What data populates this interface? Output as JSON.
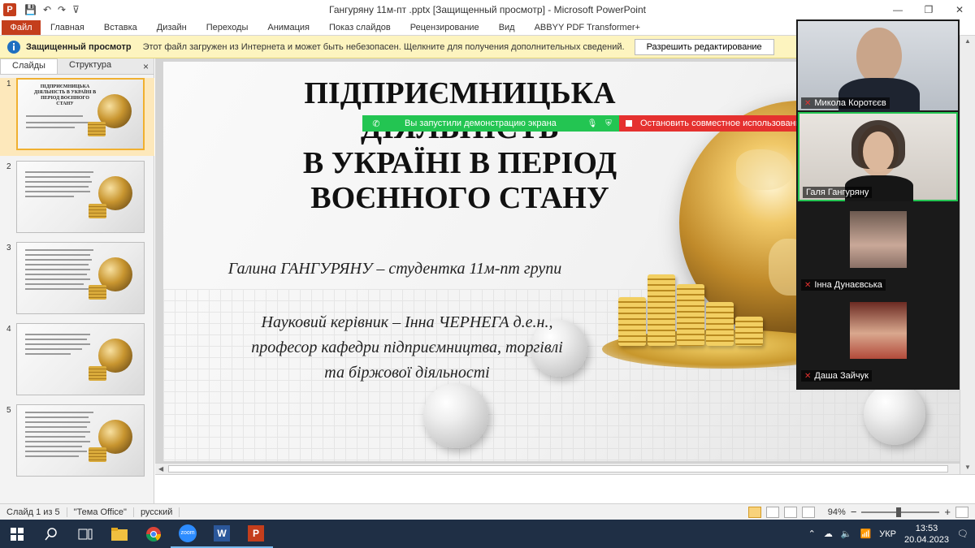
{
  "window": {
    "title": "Гангуряну 11м-пт .pptx [Защищенный просмотр]  -  Microsoft PowerPoint",
    "app_letter": "P",
    "qat_save": "💾",
    "qat_undo": "↶",
    "qat_redo": "↷",
    "qat_more": "⊽",
    "min": "—",
    "restore": "❐",
    "close": "✕"
  },
  "ribbon": {
    "file": "Файл",
    "tabs": [
      "Главная",
      "Вставка",
      "Дизайн",
      "Переходы",
      "Анимация",
      "Показ слайдов",
      "Рецензирование",
      "Вид",
      "ABBYY PDF Transformer+"
    ]
  },
  "message_bar": {
    "title": "Защищенный просмотр",
    "text": "Этот файл загружен из Интернета и может быть небезопасен. Щелкните для получения дополнительных сведений.",
    "button": "Разрешить редактирование"
  },
  "left_panel": {
    "tab_slides": "Слайды",
    "tab_outline": "Структура",
    "close": "×",
    "thumbnails": [
      {
        "num": "1",
        "title": "ПІДПРИЄМНИЦЬКА ДІЯЛЬНІСТЬ В УКРАЇНІ В ПЕРІОД ВОЄННОГО СТАНУ"
      },
      {
        "num": "2",
        "title": ""
      },
      {
        "num": "3",
        "title": ""
      },
      {
        "num": "4",
        "title": ""
      },
      {
        "num": "5",
        "title": ""
      }
    ]
  },
  "slide": {
    "title_lines": [
      "ПІДПРИЄМНИЦЬКА",
      "ДІЯЛЬНІСТЬ",
      "В УКРАЇНІ В ПЕРІОД",
      "ВОЄННОГО СТАНУ"
    ],
    "author": "Галина ГАНГУРЯНУ – студентка 11м-пт групи",
    "advisor_lines": [
      "Науковий керівник – Інна ЧЕРНЕГА  д.е.н.,",
      "професор кафедри підприємництва, торгівлі",
      "та біржової діяльності"
    ]
  },
  "share": {
    "started": "Вы запустили демонстрацию экрана",
    "stop": "Остановить совместное использование"
  },
  "videos": [
    {
      "name": "Микола Коротєєв",
      "muted": true
    },
    {
      "name": "Галя Гангуряну",
      "muted": false
    },
    {
      "name": "Інна Дунаєвська",
      "muted": true
    },
    {
      "name": "Даша Зайчук",
      "muted": true
    }
  ],
  "status": {
    "slide": "Слайд 1 из 5",
    "theme": "\"Тема Office\"",
    "language": "русский",
    "zoom": "94%",
    "zoom_level": 0.47,
    "zoom_minus": "−",
    "zoom_plus": "+"
  },
  "taskbar": {
    "lang": "УКР",
    "time": "13:53",
    "date": "20.04.2023",
    "zoom_label": "zoom",
    "word_label": "W",
    "ppt_label": "P"
  },
  "colors": {
    "accent": "#c43e1c",
    "share_green": "#23c552",
    "stop_red": "#e5312f",
    "msgbar": "#fdf4bf"
  }
}
